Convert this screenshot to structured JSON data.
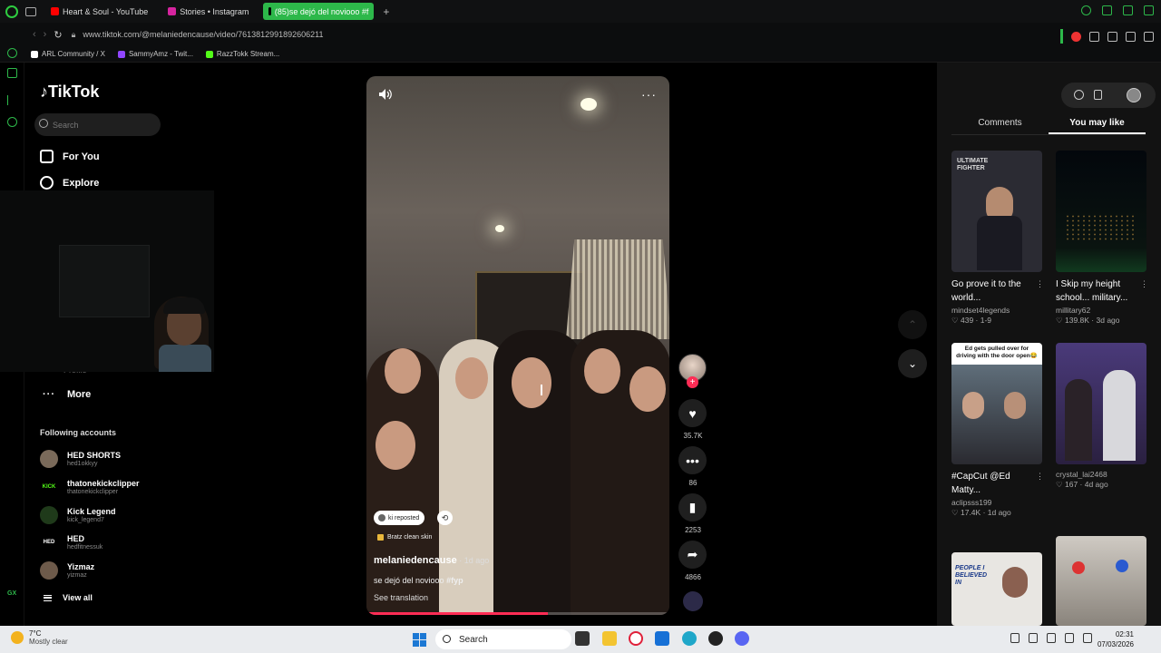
{
  "browser": {
    "tabs": [
      {
        "label": "Heart & Soul - YouTube",
        "color": "#ff0000",
        "active": false
      },
      {
        "label": "Stories • Instagram",
        "color": "#d6249f",
        "active": false
      },
      {
        "label": "(85)se dejó del noviooo #f",
        "color": "#000000",
        "active": true
      }
    ],
    "new_tab": "+",
    "url": "www.tiktok.com/@melaniedencause/video/7613812991892606211",
    "bookmarks": [
      {
        "label": "ARL Community / X",
        "color": "#ffffff"
      },
      {
        "label": "SammyAmz - Twit...",
        "color": "#9146ff"
      },
      {
        "label": "RazzTokk Stream...",
        "color": "#53fc18"
      }
    ],
    "gx_label": "GX"
  },
  "sidebar": {
    "logo": "TikTok",
    "search_placeholder": "Search",
    "nav": [
      {
        "label": "For You",
        "icon": "home-icon"
      },
      {
        "label": "Explore",
        "icon": "compass-icon"
      }
    ],
    "partial_item": "Profile",
    "more_label": "More",
    "following_title": "Following accounts",
    "accounts": [
      {
        "name": "HED SHORTS",
        "handle": "hed1okkyy",
        "badge": "",
        "badge_color": "#7a6a5a"
      },
      {
        "name": "thatonekickclipper",
        "handle": "thatonekickclipper",
        "badge": "KICK",
        "badge_color": "#000000"
      },
      {
        "name": "Kick Legend",
        "handle": "kick_legend7",
        "badge": "",
        "badge_color": "#1f3a1a"
      },
      {
        "name": "HED",
        "handle": "hedfitnessuk",
        "badge": "HED",
        "badge_color": "#000000"
      },
      {
        "name": "Yizmaz",
        "handle": "yizmaz",
        "badge": "",
        "badge_color": "#6d5a4a"
      }
    ],
    "view_all": "View all"
  },
  "video": {
    "reposted_label": "ki reposted",
    "sound": "Bratz clean skin",
    "author": "melaniedencause",
    "time_ago": " · 1d ago",
    "description": "se dejó del noviooo ",
    "hashtag": "#fyp",
    "see_translation": "See translation",
    "progress": 0.6
  },
  "actions": {
    "likes": "35.7K",
    "comments": "86",
    "saves": "2253",
    "shares": "4866"
  },
  "right_panel": {
    "tabs": [
      "Comments",
      "You may like"
    ],
    "active_tab": 1,
    "cards": [
      {
        "title": "Go prove it to the world...",
        "author": "mindset4legends",
        "likes": "439",
        "date": "1-9",
        "thumb_text": "ULTIMATE FIGHTER",
        "bg": "#2b2b33"
      },
      {
        "title": "I Skip my height school... military...",
        "author": "millitary62",
        "likes": "139.8K",
        "date": "3d ago",
        "thumb_text": "",
        "bg": "#050a0f"
      },
      {
        "title": "#CapCut @Ed Matty...",
        "author": "aclipsss199",
        "likes": "17.4K",
        "date": "1d ago",
        "thumb_text": "Ed gets pulled over for driving with the door open😂",
        "bg": "#d8dde3"
      },
      {
        "title": "",
        "author": "crystal_lai2468",
        "likes": "167",
        "date": "4d ago",
        "thumb_text": "",
        "bg": "#3a2a55"
      },
      {
        "title": "",
        "author": "",
        "likes": "",
        "date": "",
        "thumb_text": "PEOPLE I BELIEVED IN",
        "bg": "#e8e6e2"
      },
      {
        "title": "",
        "author": "",
        "likes": "",
        "date": "",
        "thumb_text": "",
        "bg": "#b9b3ab"
      }
    ]
  },
  "taskbar": {
    "temp": "7°C",
    "weather": "Mostly clear",
    "search": "Search",
    "time": "02:31",
    "date": "07/03/2026"
  }
}
